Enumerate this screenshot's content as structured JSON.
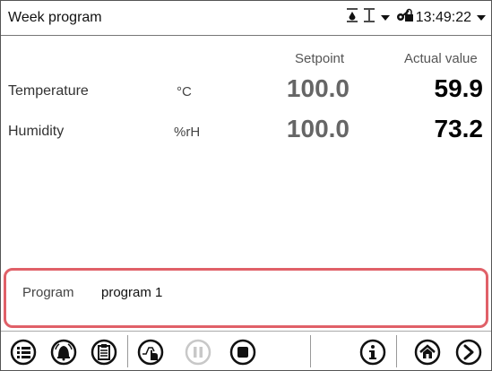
{
  "header": {
    "title": "Week program",
    "time": "13:49:22",
    "icons": [
      "humidity-status-icon",
      "temperature-status-icon",
      "dropdown-arrow-icon",
      "lock-key-icon",
      "time-dropdown-icon"
    ]
  },
  "columns": {
    "setpoint": "Setpoint",
    "actual": "Actual value"
  },
  "rows": [
    {
      "label": "Temperature",
      "unit": "°C",
      "setpoint": "100.0",
      "actual": "59.9"
    },
    {
      "label": "Humidity",
      "unit": "%rH",
      "setpoint": "100.0",
      "actual": "73.2"
    }
  ],
  "program": {
    "label": "Program",
    "value": "program 1"
  },
  "toolbar": {
    "buttons": [
      "menu-icon",
      "alarm-icon",
      "clipboard-icon",
      "program-start-icon",
      "pause-icon",
      "stop-icon",
      "info-icon",
      "home-icon",
      "next-icon"
    ]
  },
  "colors": {
    "highlight_border": "#e06068",
    "disabled": "#c8c8c8"
  }
}
